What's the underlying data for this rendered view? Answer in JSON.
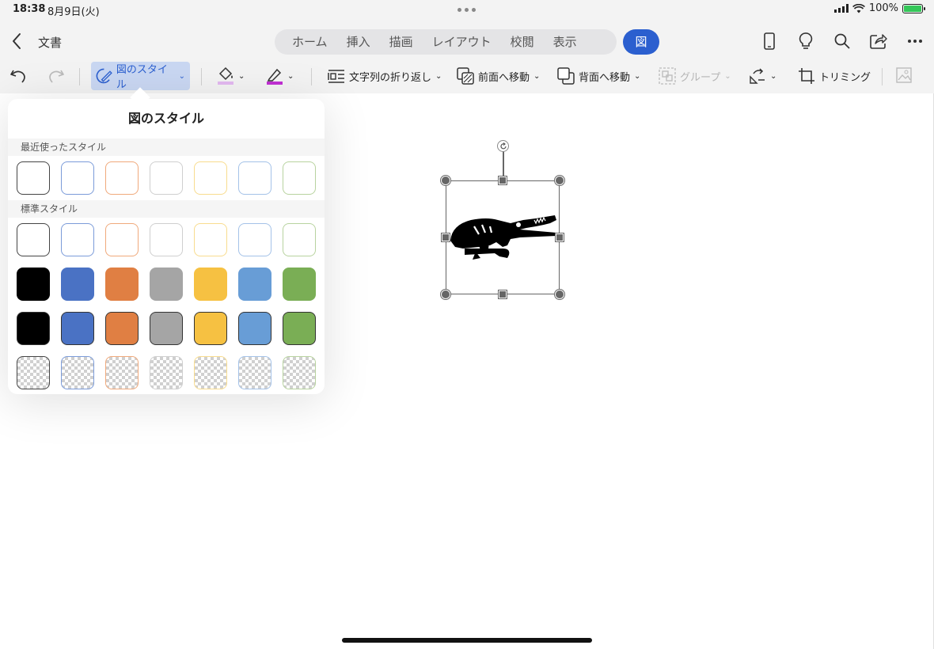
{
  "status": {
    "time": "18:38",
    "date": "8月9日(火)",
    "battery": "100%"
  },
  "nav": {
    "doc_title": "文書",
    "tabs": [
      "ホーム",
      "挿入",
      "描画",
      "レイアウト",
      "校閲",
      "表示"
    ],
    "active_tab": "図",
    "accent": "#2b5fcf",
    "icons": [
      "phone-icon",
      "lightbulb-icon",
      "search-icon",
      "share-icon",
      "more-icon"
    ]
  },
  "ribbon": {
    "picture_styles": "図のスタイル",
    "wrap_text": "文字列の折り返し",
    "bring_forward": "前面へ移動",
    "send_backward": "背面へ移動",
    "group": "グループ",
    "crop": "トリミング"
  },
  "popover": {
    "title": "図のスタイル",
    "recent_label": "最近使ったスタイル",
    "standard_label": "標準スタイル",
    "colors": {
      "black": "#000000",
      "blue": "#4a72c4",
      "orange": "#e07f43",
      "gray": "#a5a5a5",
      "yellow": "#f6c142",
      "lightblue": "#689dd6",
      "green": "#7aae55"
    }
  }
}
